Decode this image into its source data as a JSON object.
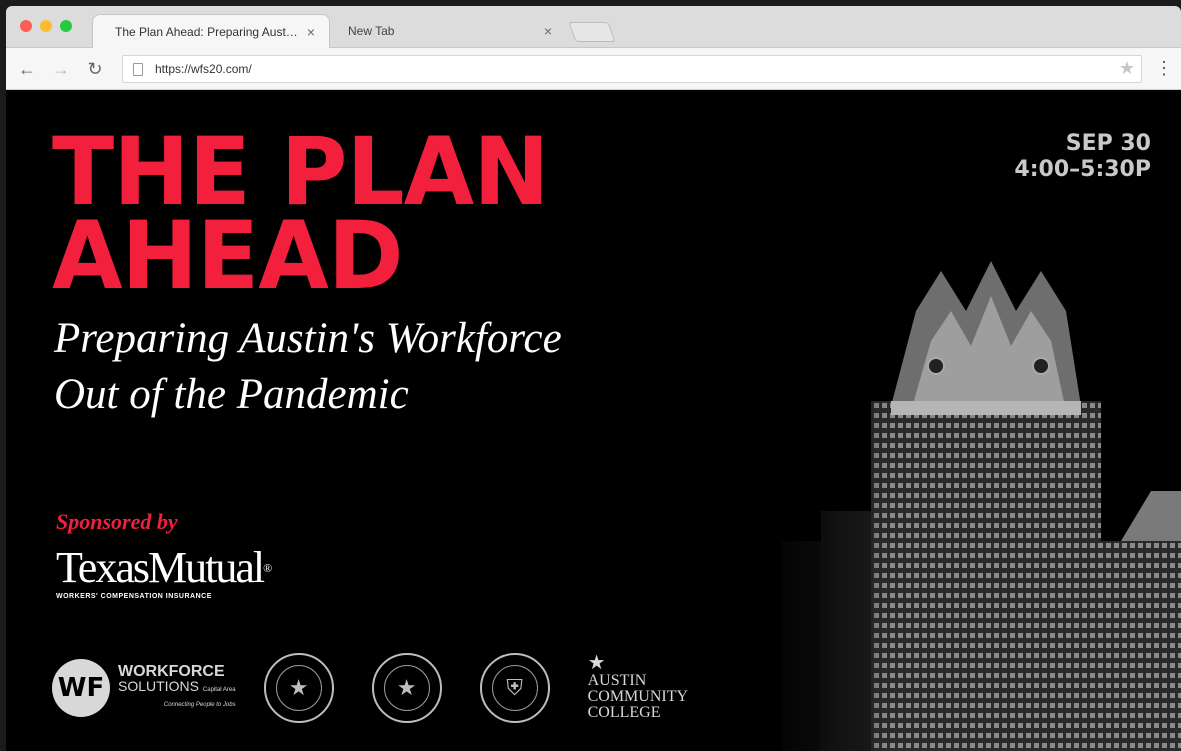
{
  "browser": {
    "tabs": [
      {
        "title": "The Plan Ahead: Preparing Austin's...",
        "close": "×"
      },
      {
        "title": "New Tab",
        "close": "×"
      }
    ],
    "url": "https://wfs20.com/"
  },
  "page": {
    "title_line1": "THE PLAN",
    "title_line2": "AHEAD",
    "subtitle_line1": "Preparing Austin's Workforce",
    "subtitle_line2": "Out of the Pandemic",
    "date": "SEP 30",
    "time": "4:00–5:30P",
    "sponsored_label": "Sponsored by",
    "sponsor_name": "TexasMutual",
    "sponsor_tagline": "WORKERS' COMPENSATION INSURANCE",
    "partners": {
      "wf_line1": "WORKFORCE",
      "wf_line2": "SOLUTIONS",
      "wf_region": "Capital Area",
      "wf_slogan": "Connecting People to Jobs",
      "acc_line1": "AUSTIN",
      "acc_line2": "COMMUNITY",
      "acc_line3": "COLLEGE"
    }
  },
  "colors": {
    "accent": "#f3203d",
    "background": "#000000"
  }
}
